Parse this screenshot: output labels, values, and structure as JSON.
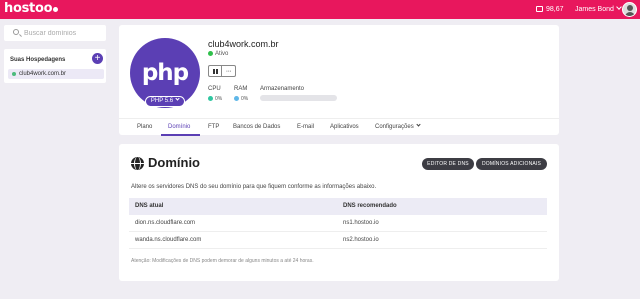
{
  "header": {
    "logo": "hostoo",
    "balance": "98,67",
    "user_name": "James Bond"
  },
  "sidebar": {
    "search_placeholder": "Buscar domínios",
    "section_title": "Suas Hospedagens",
    "add_label": "+",
    "items": [
      {
        "label": "club4work.com.br",
        "status_color": "#4cbb7d"
      }
    ]
  },
  "hosting": {
    "logo_text": "php",
    "php_version": "PHP 5.6",
    "domain": "club4work.com.br",
    "status": "Ativo",
    "controls": {
      "more": "···"
    },
    "resources": {
      "cpu_label": "CPU",
      "cpu_value": "0%",
      "ram_label": "RAM",
      "ram_value": "0%",
      "storage_label": "Armazenamento",
      "storage_fraction": 0
    },
    "tabs": [
      "Plano",
      "Domínio",
      "FTP",
      "Bancos de Dados",
      "E-mail",
      "Aplicativos",
      "Configurações"
    ],
    "active_tab": "Domínio"
  },
  "dns": {
    "title": "Domínio",
    "edit_button": "EDITOR DE DNS",
    "extra_button": "DOMÍNIOS ADICIONAIS",
    "description": "Altere os servidores DNS do seu domínio para que fiquem conforme as informações abaixo.",
    "columns": [
      "DNS atual",
      "DNS recomendado"
    ],
    "rows": [
      [
        "dion.ns.cloudflare.com",
        "ns1.hostoo.io"
      ],
      [
        "wanda.ns.cloudflare.com",
        "ns2.hostoo.io"
      ]
    ],
    "note": "Atenção: Modificações de DNS podem demorar de alguns minutos a até 24 horas."
  },
  "colors": {
    "brand": "#e8175d",
    "accent": "#5b3fb4",
    "active_status": "#2fbf4a"
  }
}
